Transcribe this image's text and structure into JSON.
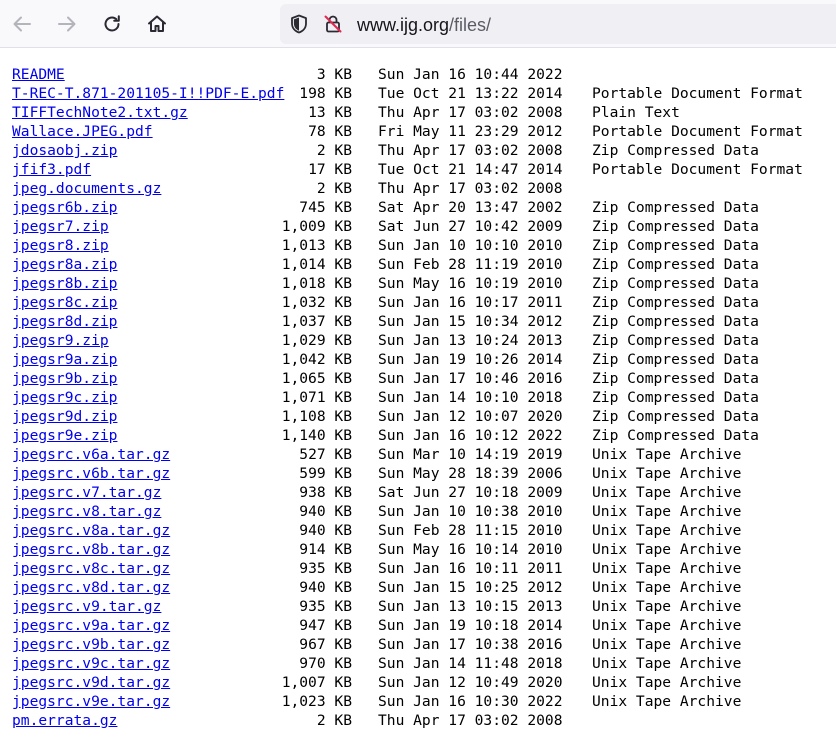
{
  "browser": {
    "url_host": "www.ijg.org",
    "url_path": "/files/"
  },
  "listing": [
    {
      "name": "README",
      "size": "3 KB",
      "date": "Sun Jan 16 10:44 2022",
      "type": ""
    },
    {
      "name": "T-REC-T.871-201105-I!!PDF-E.pdf",
      "size": "198 KB",
      "date": "Tue Oct 21 13:22 2014",
      "type": "Portable Document Format"
    },
    {
      "name": "TIFFTechNote2.txt.gz",
      "size": "13 KB",
      "date": "Thu Apr 17 03:02 2008",
      "type": "Plain Text"
    },
    {
      "name": "Wallace.JPEG.pdf",
      "size": "78 KB",
      "date": "Fri May 11 23:29 2012",
      "type": "Portable Document Format"
    },
    {
      "name": "jdosaobj.zip",
      "size": "2 KB",
      "date": "Thu Apr 17 03:02 2008",
      "type": "Zip Compressed Data"
    },
    {
      "name": "jfif3.pdf",
      "size": "17 KB",
      "date": "Tue Oct 21 14:47 2014",
      "type": "Portable Document Format"
    },
    {
      "name": "jpeg.documents.gz",
      "size": "2 KB",
      "date": "Thu Apr 17 03:02 2008",
      "type": ""
    },
    {
      "name": "jpegsr6b.zip",
      "size": "745 KB",
      "date": "Sat Apr 20 13:47 2002",
      "type": "Zip Compressed Data"
    },
    {
      "name": "jpegsr7.zip",
      "size": "1,009 KB",
      "date": "Sat Jun 27 10:42 2009",
      "type": "Zip Compressed Data"
    },
    {
      "name": "jpegsr8.zip",
      "size": "1,013 KB",
      "date": "Sun Jan 10 10:10 2010",
      "type": "Zip Compressed Data"
    },
    {
      "name": "jpegsr8a.zip",
      "size": "1,014 KB",
      "date": "Sun Feb 28 11:19 2010",
      "type": "Zip Compressed Data"
    },
    {
      "name": "jpegsr8b.zip",
      "size": "1,018 KB",
      "date": "Sun May 16 10:19 2010",
      "type": "Zip Compressed Data"
    },
    {
      "name": "jpegsr8c.zip",
      "size": "1,032 KB",
      "date": "Sun Jan 16 10:17 2011",
      "type": "Zip Compressed Data"
    },
    {
      "name": "jpegsr8d.zip",
      "size": "1,037 KB",
      "date": "Sun Jan 15 10:34 2012",
      "type": "Zip Compressed Data"
    },
    {
      "name": "jpegsr9.zip",
      "size": "1,029 KB",
      "date": "Sun Jan 13 10:24 2013",
      "type": "Zip Compressed Data"
    },
    {
      "name": "jpegsr9a.zip",
      "size": "1,042 KB",
      "date": "Sun Jan 19 10:26 2014",
      "type": "Zip Compressed Data"
    },
    {
      "name": "jpegsr9b.zip",
      "size": "1,065 KB",
      "date": "Sun Jan 17 10:46 2016",
      "type": "Zip Compressed Data"
    },
    {
      "name": "jpegsr9c.zip",
      "size": "1,071 KB",
      "date": "Sun Jan 14 10:10 2018",
      "type": "Zip Compressed Data"
    },
    {
      "name": "jpegsr9d.zip",
      "size": "1,108 KB",
      "date": "Sun Jan 12 10:07 2020",
      "type": "Zip Compressed Data"
    },
    {
      "name": "jpegsr9e.zip",
      "size": "1,140 KB",
      "date": "Sun Jan 16 10:12 2022",
      "type": "Zip Compressed Data"
    },
    {
      "name": "jpegsrc.v6a.tar.gz",
      "size": "527 KB",
      "date": "Sun Mar 10 14:19 2019",
      "type": "Unix Tape Archive"
    },
    {
      "name": "jpegsrc.v6b.tar.gz",
      "size": "599 KB",
      "date": "Sun May 28 18:39 2006",
      "type": "Unix Tape Archive"
    },
    {
      "name": "jpegsrc.v7.tar.gz",
      "size": "938 KB",
      "date": "Sat Jun 27 10:18 2009",
      "type": "Unix Tape Archive"
    },
    {
      "name": "jpegsrc.v8.tar.gz",
      "size": "940 KB",
      "date": "Sun Jan 10 10:38 2010",
      "type": "Unix Tape Archive"
    },
    {
      "name": "jpegsrc.v8a.tar.gz",
      "size": "940 KB",
      "date": "Sun Feb 28 11:15 2010",
      "type": "Unix Tape Archive"
    },
    {
      "name": "jpegsrc.v8b.tar.gz",
      "size": "914 KB",
      "date": "Sun May 16 10:14 2010",
      "type": "Unix Tape Archive"
    },
    {
      "name": "jpegsrc.v8c.tar.gz",
      "size": "935 KB",
      "date": "Sun Jan 16 10:11 2011",
      "type": "Unix Tape Archive"
    },
    {
      "name": "jpegsrc.v8d.tar.gz",
      "size": "940 KB",
      "date": "Sun Jan 15 10:25 2012",
      "type": "Unix Tape Archive"
    },
    {
      "name": "jpegsrc.v9.tar.gz",
      "size": "935 KB",
      "date": "Sun Jan 13 10:15 2013",
      "type": "Unix Tape Archive"
    },
    {
      "name": "jpegsrc.v9a.tar.gz",
      "size": "947 KB",
      "date": "Sun Jan 19 10:18 2014",
      "type": "Unix Tape Archive"
    },
    {
      "name": "jpegsrc.v9b.tar.gz",
      "size": "967 KB",
      "date": "Sun Jan 17 10:38 2016",
      "type": "Unix Tape Archive"
    },
    {
      "name": "jpegsrc.v9c.tar.gz",
      "size": "970 KB",
      "date": "Sun Jan 14 11:48 2018",
      "type": "Unix Tape Archive"
    },
    {
      "name": "jpegsrc.v9d.tar.gz",
      "size": "1,007 KB",
      "date": "Sun Jan 12 10:49 2020",
      "type": "Unix Tape Archive"
    },
    {
      "name": "jpegsrc.v9e.tar.gz",
      "size": "1,023 KB",
      "date": "Sun Jan 16 10:30 2022",
      "type": "Unix Tape Archive"
    },
    {
      "name": "pm.errata.gz",
      "size": "2 KB",
      "date": "Thu Apr 17 03:02 2008",
      "type": ""
    }
  ]
}
